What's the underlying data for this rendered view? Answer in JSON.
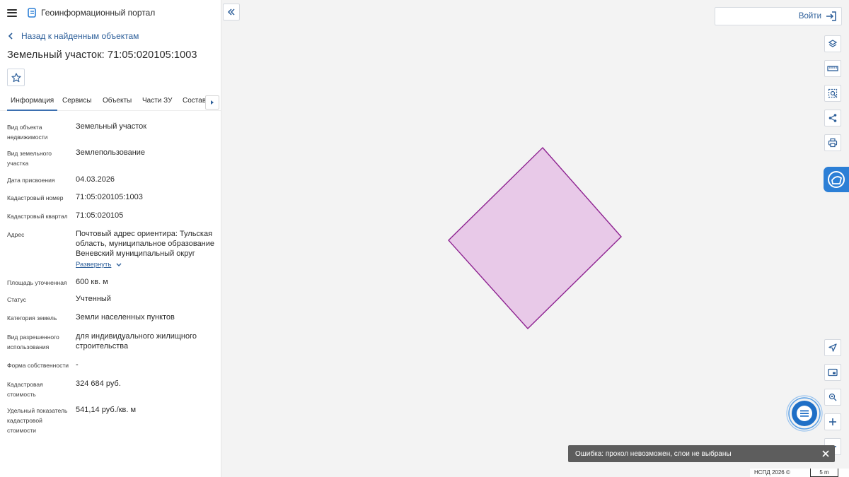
{
  "app": {
    "title": "Геоинформационный портал"
  },
  "nav": {
    "back_label": "Назад к найденным объектам"
  },
  "object": {
    "title": "Земельный участок: 71:05:020105:1003"
  },
  "tabs": [
    {
      "label": "Информация",
      "active": true
    },
    {
      "label": "Сервисы",
      "active": false
    },
    {
      "label": "Объекты",
      "active": false
    },
    {
      "label": "Части ЗУ",
      "active": false
    },
    {
      "label": "Состав",
      "active": false
    }
  ],
  "properties": [
    {
      "label_lines": [
        "Вид объекта",
        "недвижимости"
      ],
      "value_lines": [
        "Земельный участок"
      ]
    },
    {
      "label_lines": [
        "Вид земельного",
        "участка"
      ],
      "value_lines": [
        "Землепользование"
      ]
    },
    {
      "label_lines": [
        "Дата присвоения"
      ],
      "value_lines": [
        "04.03.2026"
      ]
    },
    {
      "label_lines": [
        "Кадастровый номер"
      ],
      "value_lines": [
        "71:05:020105:1003"
      ]
    },
    {
      "label_lines": [
        "Кадастровый квартал"
      ],
      "value_lines": [
        "71:05:020105"
      ]
    },
    {
      "label_lines": [
        "Адрес"
      ],
      "value_lines": [
        "Почтовый адрес ориентира: Тульская",
        "область, муниципальное образование",
        "Веневский муниципальный округ"
      ]
    },
    {
      "label_lines": [
        "Площадь уточненная"
      ],
      "value_lines": [
        "600 кв. м"
      ]
    },
    {
      "label_lines": [
        "Статус"
      ],
      "value_lines": [
        "Учтенный"
      ]
    },
    {
      "label_lines": [
        "Категория земель"
      ],
      "value_lines": [
        "Земли населенных пунктов"
      ]
    },
    {
      "label_lines": [
        "Вид разрешенного",
        "использования"
      ],
      "value_lines": [
        "для индивидуального жилищного",
        "строительства"
      ]
    },
    {
      "label_lines": [
        "Форма собственности"
      ],
      "value_lines": [
        "-"
      ]
    },
    {
      "label_lines": [
        "Кадастровая",
        "стоимость"
      ],
      "value_lines": [
        "324 684 руб."
      ]
    },
    {
      "label_lines": [
        "Удельный показатель",
        "кадастровой",
        "стоимости"
      ],
      "value_lines": [
        "541,14 руб./кв. м"
      ]
    }
  ],
  "address_expand_label": "Развернуть",
  "header": {
    "login_label": "Войти"
  },
  "toast": {
    "message": "Ошибка: прокол невозможен, слои не выбраны"
  },
  "attribution": {
    "text": "НСПД 2026 ©",
    "scale": "5 m"
  },
  "icons": {
    "menu": "hamburger-icon",
    "logo": "logo-icon",
    "back": "chevron-left-icon",
    "favorite": "star-icon",
    "tab_next": "chevron-right-icon",
    "collapse": "double-chevron-left-icon",
    "login": "login-icon",
    "tools": [
      "layers-icon",
      "ruler-icon",
      "select-area-icon",
      "share-icon",
      "print-icon",
      "locate-icon",
      "basemap-icon",
      "pin-icon",
      "zoom-in-icon",
      "zoom-out-icon"
    ],
    "assistant": "assistant-icon",
    "chat": "chat-icon",
    "close": "close-icon"
  },
  "colors": {
    "accent": "#2d5f9a",
    "tab_underline": "#3b6fb0",
    "parcel_fill": "#e8c9e8",
    "parcel_stroke": "#8e2391",
    "assistant_bg": "#2c7fd6",
    "toast_bg": "#5d5d5d"
  }
}
